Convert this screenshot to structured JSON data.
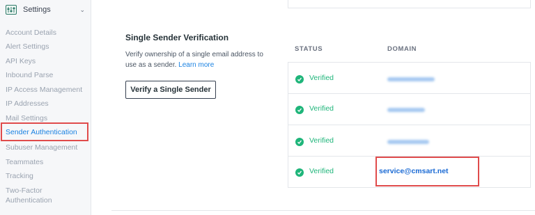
{
  "sidebar": {
    "header": {
      "label": "Settings",
      "icon": "settings-sliders-icon",
      "chevron": "chevron-down-icon"
    },
    "items": [
      {
        "label": "Account Details"
      },
      {
        "label": "Alert Settings"
      },
      {
        "label": "API Keys"
      },
      {
        "label": "Inbound Parse"
      },
      {
        "label": "IP Access Management"
      },
      {
        "label": "IP Addresses"
      },
      {
        "label": "Mail Settings"
      },
      {
        "label": "Sender Authentication",
        "active": true
      },
      {
        "label": "Subuser Management"
      },
      {
        "label": "Teammates"
      },
      {
        "label": "Tracking"
      },
      {
        "label": "Two-Factor"
      },
      {
        "label": "Authentication"
      }
    ]
  },
  "main": {
    "title": "Single Sender Verification",
    "description": "Verify ownership of a single email address to use as a sender.",
    "learn_more": "Learn more",
    "verify_button": "Verify a Single Sender",
    "table": {
      "columns": [
        "STATUS",
        "DOMAIN"
      ],
      "rows": [
        {
          "status": "Verified",
          "domain": "",
          "domain_obscured": true
        },
        {
          "status": "Verified",
          "domain": "",
          "domain_obscured": true
        },
        {
          "status": "Verified",
          "domain": "",
          "domain_obscured": true
        },
        {
          "status": "Verified",
          "domain": "service@cmsart.net",
          "domain_obscured": false
        }
      ]
    }
  },
  "colors": {
    "accent": "#1a82e2",
    "verified": "#1fb57a",
    "highlight": "#e04b4b"
  }
}
